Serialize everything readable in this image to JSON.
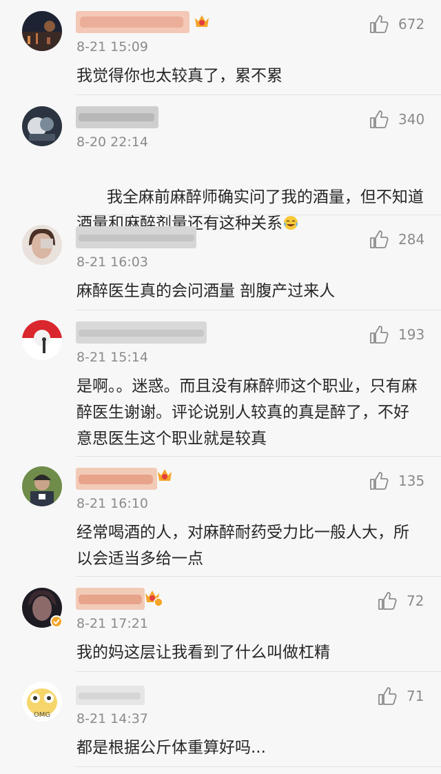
{
  "colors": {
    "background": "#f7f7f7",
    "text": "#262626",
    "meta": "#8a8a8a",
    "divider": "#e2e2e2",
    "crown": "#f4a52a"
  },
  "comments": [
    {
      "avatar": "night-city-avatar",
      "badge": "crown-badge",
      "time": "8-21 15:09",
      "text": "我觉得你也太较真了，累不累",
      "likes": "672"
    },
    {
      "avatar": "dark-art-avatar",
      "badge": null,
      "time": "8-20 22:14",
      "text": "我全麻前麻醉师确实问了我的酒量，但不知道酒量和麻醉剂量还有这种关系",
      "emoji": "laughing-tears-emoji",
      "likes": "340"
    },
    {
      "avatar": "girl-photo-avatar",
      "badge": null,
      "time": "8-21 16:03",
      "text": "麻醉医生真的会问酒量 剖腹产过来人",
      "likes": "284"
    },
    {
      "avatar": "red-sun-avatar",
      "badge": null,
      "time": "8-21 15:14",
      "text": "是啊。。迷惑。而且没有麻醉师这个职业，只有麻醉医生谢谢。评论说别人较真的真是醉了，不好意思医生这个职业就是较真",
      "likes": "193"
    },
    {
      "avatar": "outdoor-person-avatar",
      "badge": "crown-badge",
      "time": "8-21 16:10",
      "text": "经常喝酒的人，对麻醉耐药受力比一般人大，所以会适当多给一点",
      "likes": "135"
    },
    {
      "avatar": "dark-portrait-avatar",
      "badge": "crown-level-badge",
      "time": "8-21 17:21",
      "text": "我的妈这层让我看到了什么叫做杠精",
      "likes": "72"
    },
    {
      "avatar": "omg-cartoon-avatar",
      "badge": null,
      "time": "8-21 14:37",
      "text": "都是根据公斤体重算好吗...",
      "likes": "71"
    }
  ]
}
